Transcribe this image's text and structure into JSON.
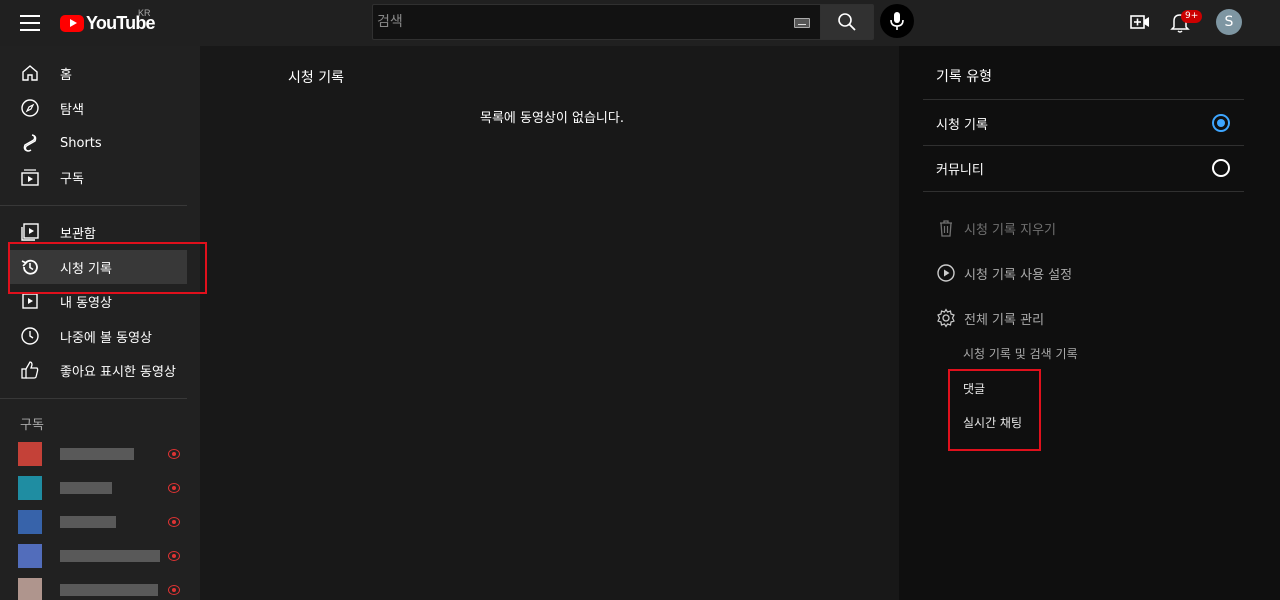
{
  "header": {
    "logo_text": "YouTube",
    "region": "KR",
    "search_placeholder": "검색",
    "notification_count": "9+",
    "avatar_letter": "S"
  },
  "sidebar": {
    "primary": [
      {
        "label": "홈",
        "icon": "home-icon"
      },
      {
        "label": "탐색",
        "icon": "compass-icon"
      },
      {
        "label": "Shorts",
        "icon": "shorts-icon"
      },
      {
        "label": "구독",
        "icon": "subscriptions-icon"
      }
    ],
    "library": [
      {
        "label": "보관함",
        "icon": "library-icon"
      },
      {
        "label": "시청 기록",
        "icon": "history-icon",
        "active": true
      },
      {
        "label": "내 동영상",
        "icon": "my-videos-icon"
      },
      {
        "label": "나중에 볼 동영상",
        "icon": "watch-later-icon"
      },
      {
        "label": "좋아요 표시한 동영상",
        "icon": "thumbs-up-icon"
      }
    ],
    "subscriptions_title": "구독",
    "subscriptions": [
      {
        "avatar_color": "#e0463c",
        "live": true
      },
      {
        "avatar_color": "#1fa0b8",
        "live": true
      },
      {
        "avatar_color": "#3b6fc2",
        "live": true
      },
      {
        "avatar_color": "#5a7ad6",
        "live": true
      },
      {
        "avatar_color": "#c8a9a0",
        "live": true
      }
    ]
  },
  "main": {
    "title": "시청 기록",
    "empty_message": "목록에 동영상이 없습니다."
  },
  "panel": {
    "title": "기록 유형",
    "options": [
      {
        "label": "시청 기록",
        "selected": true
      },
      {
        "label": "커뮤니티",
        "selected": false
      }
    ],
    "actions": [
      {
        "label": "시청 기록 지우기",
        "icon": "trash-icon",
        "disabled": true
      },
      {
        "label": "시청 기록 사용 설정",
        "icon": "play-circle-icon",
        "disabled": false
      },
      {
        "label": "전체 기록 관리",
        "icon": "gear-icon",
        "disabled": false
      }
    ],
    "manage_links": [
      "시청 기록 및 검색 기록",
      "댓글",
      "실시간 채팅"
    ]
  },
  "colors": {
    "background": "#181818",
    "sidebar": "#212121",
    "panel": "#0f0f0f",
    "accent": "#3ea6ff",
    "brand_red": "#ff0000",
    "annotation_red": "#e0101c"
  }
}
